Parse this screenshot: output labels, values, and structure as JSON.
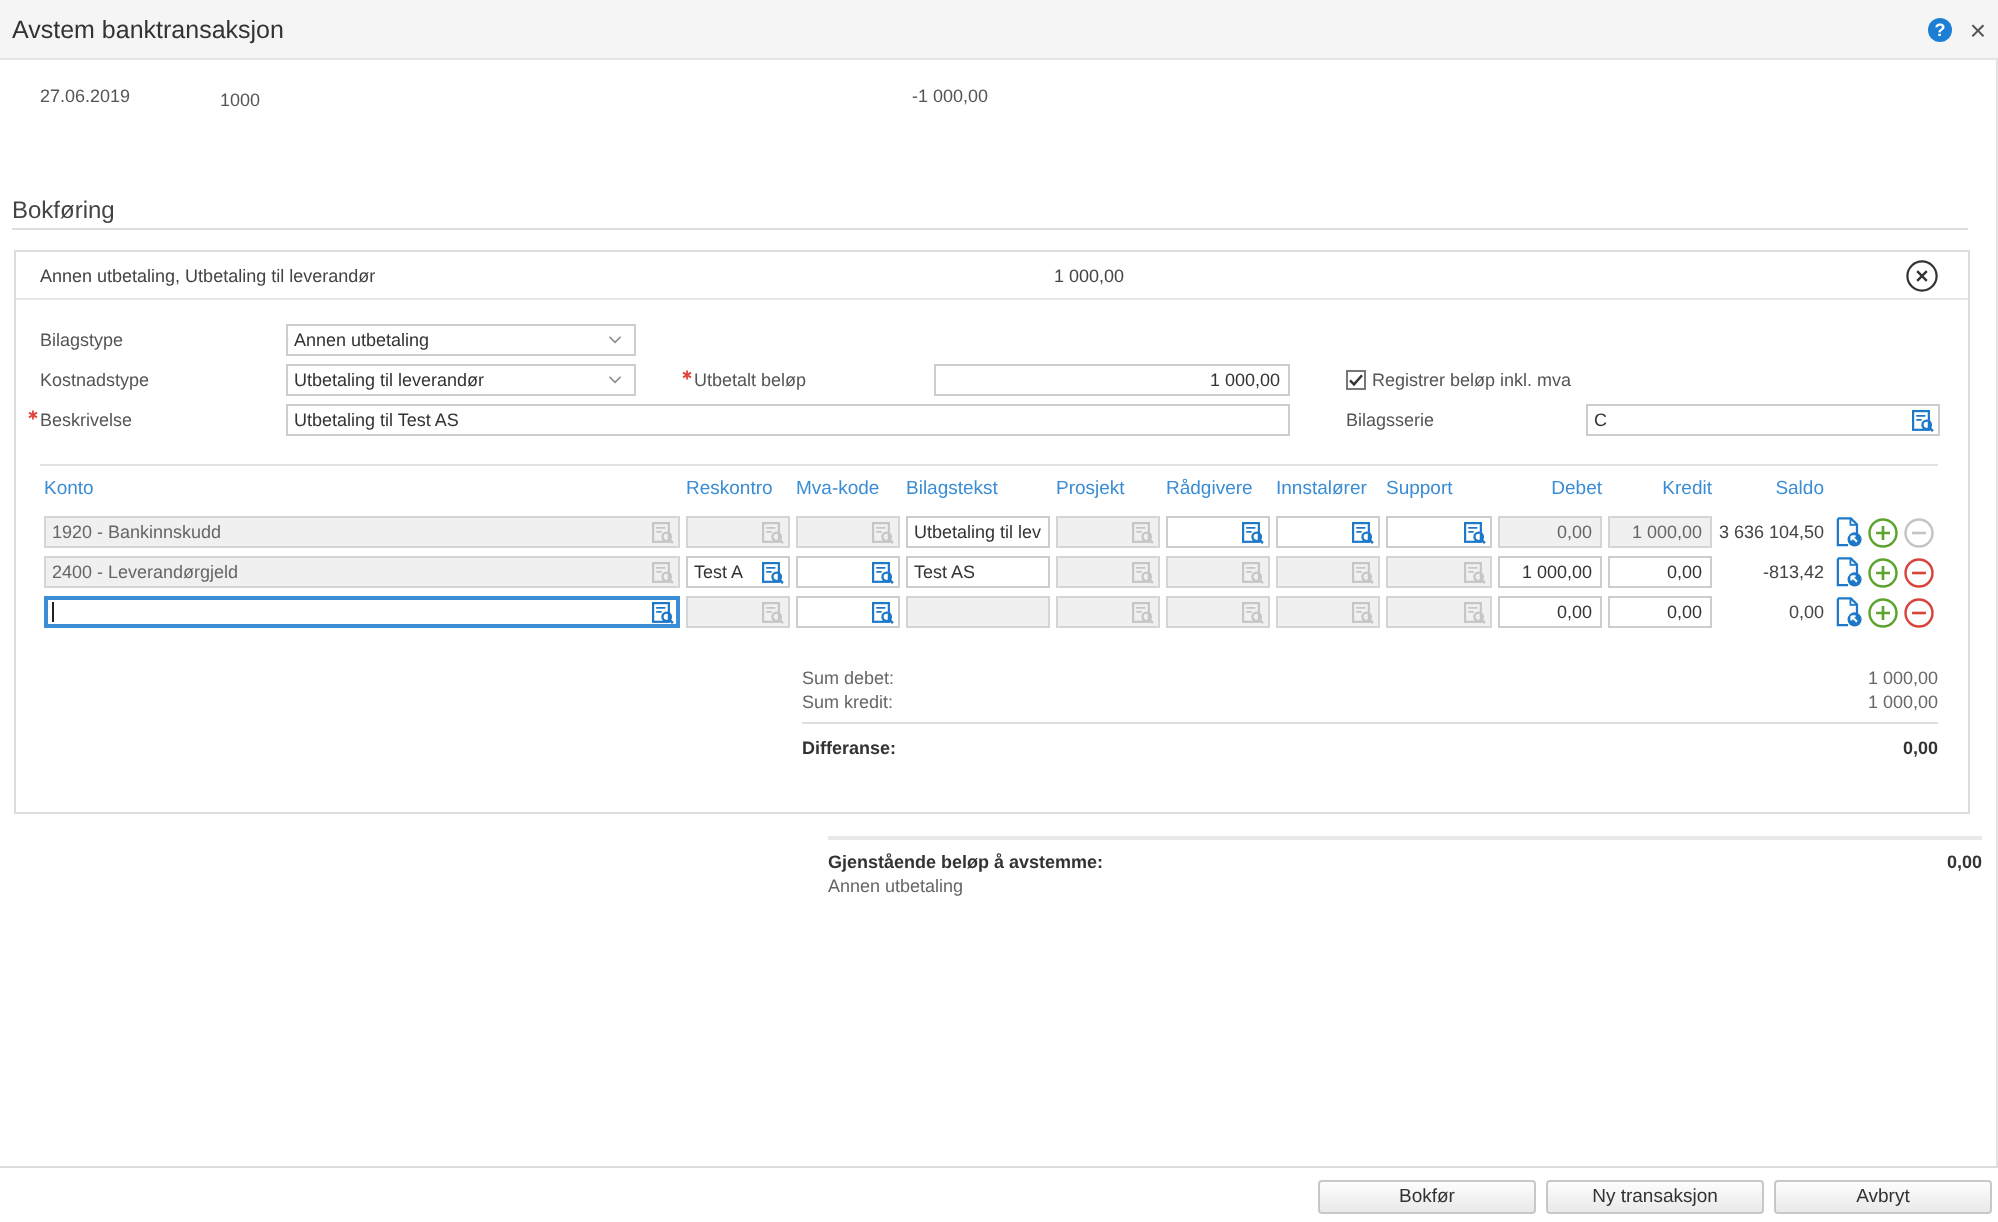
{
  "window": {
    "title": "Avstem banktransaksjon",
    "help": "?",
    "close": "×"
  },
  "transaction": {
    "date": "27.06.2019",
    "account": "1000",
    "amount": "-1 000,00"
  },
  "section": {
    "title": "Bokføring"
  },
  "entry": {
    "title": "Annen utbetaling, Utbetaling til leverandør",
    "amount": "1 000,00",
    "voucher_type": {
      "label": "Bilagstype",
      "value": "Annen utbetaling",
      "required": false
    },
    "cost_type": {
      "label": "Kostnadstype",
      "value": "Utbetaling til leverandør",
      "required": false
    },
    "paid_amount": {
      "label": "Utbetalt beløp",
      "value": "1 000,00",
      "required": true
    },
    "include_vat": {
      "label": "Registrer beløp inkl. mva",
      "checked": true
    },
    "description": {
      "label": "Beskrivelse",
      "value": "Utbetaling til Test AS",
      "required": true
    },
    "voucher_series": {
      "label": "Bilagsserie",
      "value": "C",
      "required": false
    }
  },
  "ledger": {
    "columns": [
      {
        "label": "Konto",
        "kind": "lookup"
      },
      {
        "label": "Reskontro",
        "kind": "lookup"
      },
      {
        "label": "Mva-kode",
        "kind": "lookup"
      },
      {
        "label": "Bilagstekst",
        "kind": "text"
      },
      {
        "label": "Prosjekt",
        "kind": "lookup"
      },
      {
        "label": "Rådgivere",
        "kind": "lookup"
      },
      {
        "label": "Innstalører",
        "kind": "lookup"
      },
      {
        "label": "Support",
        "kind": "lookup"
      },
      {
        "label": "Debet",
        "kind": "amount"
      },
      {
        "label": "Kredit",
        "kind": "amount"
      },
      {
        "label": "Saldo",
        "kind": "balance"
      }
    ],
    "rows": [
      {
        "cells": [
          {
            "value": "1920 - Bankinnskudd",
            "disabled": true,
            "focused": false
          },
          {
            "disabled": true,
            "focused": false
          },
          {
            "disabled": true,
            "focused": false
          },
          {
            "value": "Utbetaling til lev",
            "disabled": false,
            "focused": false
          },
          {
            "disabled": true,
            "focused": false
          },
          {
            "disabled": false,
            "focused": false
          },
          {
            "disabled": false,
            "focused": false
          },
          {
            "disabled": false,
            "focused": false
          },
          {
            "value": "0,00",
            "disabled": true,
            "focused": false
          },
          {
            "value": "1 000,00",
            "disabled": true,
            "focused": false
          }
        ],
        "balance": "3 636 104,50",
        "remove_disabled": true
      },
      {
        "cells": [
          {
            "value": "2400 - Leverandørgjeld",
            "disabled": true,
            "focused": false
          },
          {
            "value": "Test A",
            "disabled": false,
            "focused": false
          },
          {
            "disabled": false,
            "focused": false
          },
          {
            "value": "Test AS",
            "disabled": false,
            "focused": false
          },
          {
            "disabled": true,
            "focused": false
          },
          {
            "disabled": true,
            "focused": false
          },
          {
            "disabled": true,
            "focused": false
          },
          {
            "disabled": true,
            "focused": false
          },
          {
            "value": "1 000,00",
            "disabled": false,
            "focused": false
          },
          {
            "value": "0,00",
            "disabled": false,
            "focused": false
          }
        ],
        "balance": "-813,42",
        "remove_disabled": false
      },
      {
        "cells": [
          {
            "disabled": false,
            "focused": true
          },
          {
            "disabled": true,
            "focused": false
          },
          {
            "disabled": false,
            "focused": false
          },
          {
            "disabled": true,
            "focused": false
          },
          {
            "disabled": true,
            "focused": false
          },
          {
            "disabled": true,
            "focused": false
          },
          {
            "disabled": true,
            "focused": false
          },
          {
            "disabled": true,
            "focused": false
          },
          {
            "value": "0,00",
            "disabled": false,
            "focused": false
          },
          {
            "value": "0,00",
            "disabled": false,
            "focused": false
          }
        ],
        "balance": "0,00",
        "remove_disabled": false
      }
    ]
  },
  "summary": {
    "lines": [
      {
        "label": "Sum debet:",
        "value": "1 000,00"
      },
      {
        "label": "Sum kredit:",
        "value": "1 000,00"
      }
    ],
    "difference": {
      "label": "Differanse:",
      "value": "0,00"
    }
  },
  "remaining": {
    "label": "Gjenstående beløp å avstemme:",
    "value": "0,00",
    "note": "Annen utbetaling"
  },
  "buttons": [
    {
      "label": "Bokfør"
    },
    {
      "label": "Ny transaksjon"
    },
    {
      "label": "Avbryt"
    }
  ]
}
